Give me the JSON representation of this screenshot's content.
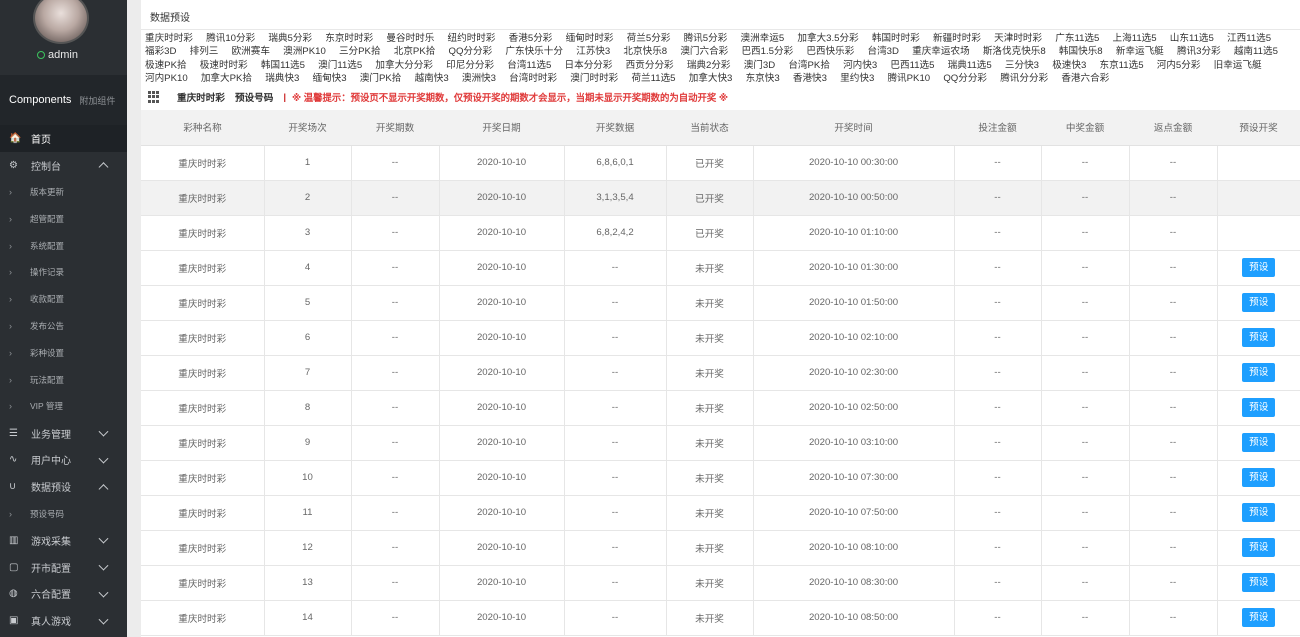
{
  "sidebar": {
    "username": "admin",
    "components_title": "Components",
    "components_sub": "附加组件",
    "items": [
      {
        "label": "首页",
        "icon": "home-icon",
        "glyph": "🏠",
        "type": "main",
        "active": true,
        "chevron": ""
      },
      {
        "label": "控制台",
        "icon": "gear-icon",
        "glyph": "⚙",
        "type": "main",
        "active": false,
        "chevron": "up"
      },
      {
        "label": "版本更新",
        "icon": "chevron-right-icon",
        "glyph": "›",
        "type": "sub",
        "active": false,
        "chevron": ""
      },
      {
        "label": "超管配置",
        "icon": "chevron-right-icon",
        "glyph": "›",
        "type": "sub",
        "active": false,
        "chevron": ""
      },
      {
        "label": "系统配置",
        "icon": "chevron-right-icon",
        "glyph": "›",
        "type": "sub",
        "active": false,
        "chevron": ""
      },
      {
        "label": "操作记录",
        "icon": "chevron-right-icon",
        "glyph": "›",
        "type": "sub",
        "active": false,
        "chevron": ""
      },
      {
        "label": "收款配置",
        "icon": "chevron-right-icon",
        "glyph": "›",
        "type": "sub",
        "active": false,
        "chevron": ""
      },
      {
        "label": "发布公告",
        "icon": "chevron-right-icon",
        "glyph": "›",
        "type": "sub",
        "active": false,
        "chevron": ""
      },
      {
        "label": "彩种设置",
        "icon": "chevron-right-icon",
        "glyph": "›",
        "type": "sub",
        "active": false,
        "chevron": ""
      },
      {
        "label": "玩法配置",
        "icon": "chevron-right-icon",
        "glyph": "›",
        "type": "sub",
        "active": false,
        "chevron": ""
      },
      {
        "label": "VIP 管理",
        "icon": "chevron-right-icon",
        "glyph": "›",
        "type": "sub",
        "active": false,
        "chevron": ""
      },
      {
        "label": "业务管理",
        "icon": "list-icon",
        "glyph": "☰",
        "type": "main",
        "active": false,
        "chevron": "down"
      },
      {
        "label": "用户中心",
        "icon": "pulse-icon",
        "glyph": "∿",
        "type": "main",
        "active": false,
        "chevron": "down"
      },
      {
        "label": "数据预设",
        "icon": "magnet-icon",
        "glyph": "∪",
        "type": "main",
        "active": false,
        "chevron": "up"
      },
      {
        "label": "预设号码",
        "icon": "chevron-right-icon",
        "glyph": "›",
        "type": "sub",
        "active": false,
        "chevron": ""
      },
      {
        "label": "游戏采集",
        "icon": "bars-icon",
        "glyph": "▥",
        "type": "main",
        "active": false,
        "chevron": "down"
      },
      {
        "label": "开市配置",
        "icon": "file-icon",
        "glyph": "▢",
        "type": "main",
        "active": false,
        "chevron": "down"
      },
      {
        "label": "六合配置",
        "icon": "globe-icon",
        "glyph": "◍",
        "type": "main",
        "active": false,
        "chevron": "down"
      },
      {
        "label": "真人游戏",
        "icon": "gamepad-icon",
        "glyph": "▣",
        "type": "main",
        "active": false,
        "chevron": "down"
      }
    ]
  },
  "page": {
    "title": "数据预设"
  },
  "lottery_links": [
    "重庆时时彩",
    "腾讯10分彩",
    "瑞典5分彩",
    "东京时时彩",
    "曼谷时时乐",
    "纽约时时彩",
    "香港5分彩",
    "缅甸时时彩",
    "荷兰5分彩",
    "腾讯5分彩",
    "澳洲幸运5",
    "加拿大3.5分彩",
    "韩国时时彩",
    "新疆时时彩",
    "天津时时彩",
    "广东11选5",
    "上海11选5",
    "山东11选5",
    "江西11选5",
    "福彩3D",
    "排列三",
    "欧洲赛车",
    "澳洲PK10",
    "三分PK拾",
    "北京PK拾",
    "QQ分分彩",
    "广东快乐十分",
    "江苏快3",
    "北京快乐8",
    "澳门六合彩",
    "巴西1.5分彩",
    "巴西快乐彩",
    "台湾3D",
    "重庆幸运农场",
    "斯洛伐克快乐8",
    "韩国快乐8",
    "新幸运飞艇",
    "腾讯3分彩",
    "越南11选5",
    "极速PK拾",
    "极速时时彩",
    "韩国11选5",
    "澳门11选5",
    "加拿大分分彩",
    "印尼分分彩",
    "台湾11选5",
    "日本分分彩",
    "西贡分分彩",
    "瑞典2分彩",
    "澳门3D",
    "台湾PK拾",
    "河内快3",
    "巴西11选5",
    "瑞典11选5",
    "三分快3",
    "极速快3",
    "东京11选5",
    "河内5分彩",
    "旧幸运飞艇",
    "河内PK10",
    "加拿大PK拾",
    "瑞典快3",
    "缅甸快3",
    "澳门PK拾",
    "越南快3",
    "澳洲快3",
    "台湾时时彩",
    "澳门时时彩",
    "荷兰11选5",
    "加拿大快3",
    "东京快3",
    "香港快3",
    "里约快3",
    "腾讯PK10",
    "QQ分分彩",
    "腾讯分分彩",
    "香港六合彩"
  ],
  "toolbar": {
    "tab_current": "重庆时时彩",
    "tab_preset": "预设号码",
    "separator": "|",
    "notice": "※ 温馨提示：预设页不显示开奖期数，仅预设开奖的期数才会显示，当期未显示开奖期数的为自动开奖 ※"
  },
  "table": {
    "headers": [
      "彩种名称",
      "开奖场次",
      "开奖期数",
      "开奖日期",
      "开奖数据",
      "当前状态",
      "开奖时间",
      "投注金额",
      "中奖金额",
      "返点金额",
      "预设开奖"
    ],
    "button_label": "预设",
    "rows": [
      {
        "name": "重庆时时彩",
        "round": "1",
        "issue": "--",
        "date": "2020-10-10",
        "data": "6,8,6,0,1",
        "status": "已开奖",
        "time": "2020-10-10 00:30:00",
        "bet": "--",
        "win": "--",
        "rebate": "--",
        "preset": false
      },
      {
        "name": "重庆时时彩",
        "round": "2",
        "issue": "--",
        "date": "2020-10-10",
        "data": "3,1,3,5,4",
        "status": "已开奖",
        "time": "2020-10-10 00:50:00",
        "bet": "--",
        "win": "--",
        "rebate": "--",
        "preset": false
      },
      {
        "name": "重庆时时彩",
        "round": "3",
        "issue": "--",
        "date": "2020-10-10",
        "data": "6,8,2,4,2",
        "status": "已开奖",
        "time": "2020-10-10 01:10:00",
        "bet": "--",
        "win": "--",
        "rebate": "--",
        "preset": false
      },
      {
        "name": "重庆时时彩",
        "round": "4",
        "issue": "--",
        "date": "2020-10-10",
        "data": "--",
        "status": "未开奖",
        "time": "2020-10-10 01:30:00",
        "bet": "--",
        "win": "--",
        "rebate": "--",
        "preset": true
      },
      {
        "name": "重庆时时彩",
        "round": "5",
        "issue": "--",
        "date": "2020-10-10",
        "data": "--",
        "status": "未开奖",
        "time": "2020-10-10 01:50:00",
        "bet": "--",
        "win": "--",
        "rebate": "--",
        "preset": true
      },
      {
        "name": "重庆时时彩",
        "round": "6",
        "issue": "--",
        "date": "2020-10-10",
        "data": "--",
        "status": "未开奖",
        "time": "2020-10-10 02:10:00",
        "bet": "--",
        "win": "--",
        "rebate": "--",
        "preset": true
      },
      {
        "name": "重庆时时彩",
        "round": "7",
        "issue": "--",
        "date": "2020-10-10",
        "data": "--",
        "status": "未开奖",
        "time": "2020-10-10 02:30:00",
        "bet": "--",
        "win": "--",
        "rebate": "--",
        "preset": true
      },
      {
        "name": "重庆时时彩",
        "round": "8",
        "issue": "--",
        "date": "2020-10-10",
        "data": "--",
        "status": "未开奖",
        "time": "2020-10-10 02:50:00",
        "bet": "--",
        "win": "--",
        "rebate": "--",
        "preset": true
      },
      {
        "name": "重庆时时彩",
        "round": "9",
        "issue": "--",
        "date": "2020-10-10",
        "data": "--",
        "status": "未开奖",
        "time": "2020-10-10 03:10:00",
        "bet": "--",
        "win": "--",
        "rebate": "--",
        "preset": true
      },
      {
        "name": "重庆时时彩",
        "round": "10",
        "issue": "--",
        "date": "2020-10-10",
        "data": "--",
        "status": "未开奖",
        "time": "2020-10-10 07:30:00",
        "bet": "--",
        "win": "--",
        "rebate": "--",
        "preset": true
      },
      {
        "name": "重庆时时彩",
        "round": "11",
        "issue": "--",
        "date": "2020-10-10",
        "data": "--",
        "status": "未开奖",
        "time": "2020-10-10 07:50:00",
        "bet": "--",
        "win": "--",
        "rebate": "--",
        "preset": true
      },
      {
        "name": "重庆时时彩",
        "round": "12",
        "issue": "--",
        "date": "2020-10-10",
        "data": "--",
        "status": "未开奖",
        "time": "2020-10-10 08:10:00",
        "bet": "--",
        "win": "--",
        "rebate": "--",
        "preset": true
      },
      {
        "name": "重庆时时彩",
        "round": "13",
        "issue": "--",
        "date": "2020-10-10",
        "data": "--",
        "status": "未开奖",
        "time": "2020-10-10 08:30:00",
        "bet": "--",
        "win": "--",
        "rebate": "--",
        "preset": true
      },
      {
        "name": "重庆时时彩",
        "round": "14",
        "issue": "--",
        "date": "2020-10-10",
        "data": "--",
        "status": "未开奖",
        "time": "2020-10-10 08:50:00",
        "bet": "--",
        "win": "--",
        "rebate": "--",
        "preset": true
      }
    ]
  },
  "colors": {
    "sidebar_bg": "#2b2f33",
    "accent_button": "#1e9fff",
    "notice_red": "#e03b3b",
    "online_green": "#3cc45e"
  }
}
